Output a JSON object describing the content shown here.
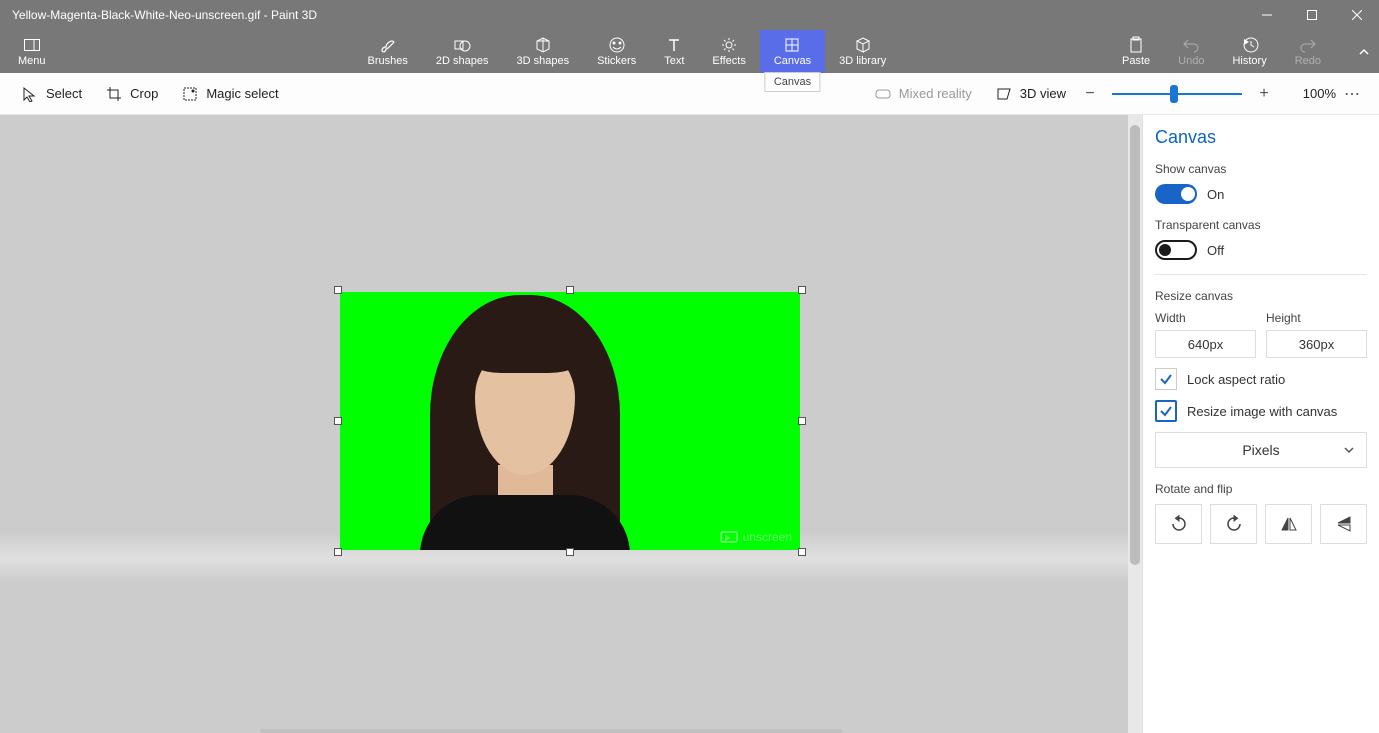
{
  "titlebar": {
    "title": "Yellow-Magenta-Black-White-Neo-unscreen.gif - Paint 3D"
  },
  "ribbon": {
    "menu": "Menu",
    "items": [
      {
        "label": "Brushes",
        "icon": "brushes"
      },
      {
        "label": "2D shapes",
        "icon": "shapes2d"
      },
      {
        "label": "3D shapes",
        "icon": "shapes3d"
      },
      {
        "label": "Stickers",
        "icon": "stickers"
      },
      {
        "label": "Text",
        "icon": "text"
      },
      {
        "label": "Effects",
        "icon": "effects"
      },
      {
        "label": "Canvas",
        "icon": "canvas",
        "active": true,
        "tooltip": "Canvas"
      },
      {
        "label": "3D library",
        "icon": "library3d"
      }
    ],
    "right": [
      {
        "label": "Paste",
        "icon": "paste"
      },
      {
        "label": "Undo",
        "icon": "undo",
        "disabled": true
      },
      {
        "label": "History",
        "icon": "history"
      },
      {
        "label": "Redo",
        "icon": "redo",
        "disabled": true
      }
    ]
  },
  "toolbar": {
    "select": "Select",
    "crop": "Crop",
    "magic": "Magic select",
    "mixed": "Mixed reality",
    "view3d": "3D view",
    "zoom": "100%"
  },
  "canvas": {
    "watermark": "unscreen"
  },
  "panel": {
    "title": "Canvas",
    "show_canvas_label": "Show canvas",
    "show_canvas_state": "On",
    "transparent_label": "Transparent canvas",
    "transparent_state": "Off",
    "resize_label": "Resize canvas",
    "width_label": "Width",
    "width_value": "640px",
    "height_label": "Height",
    "height_value": "360px",
    "lock_aspect": "Lock aspect ratio",
    "resize_with_canvas": "Resize image with canvas",
    "units": "Pixels",
    "rotate_label": "Rotate and flip"
  }
}
